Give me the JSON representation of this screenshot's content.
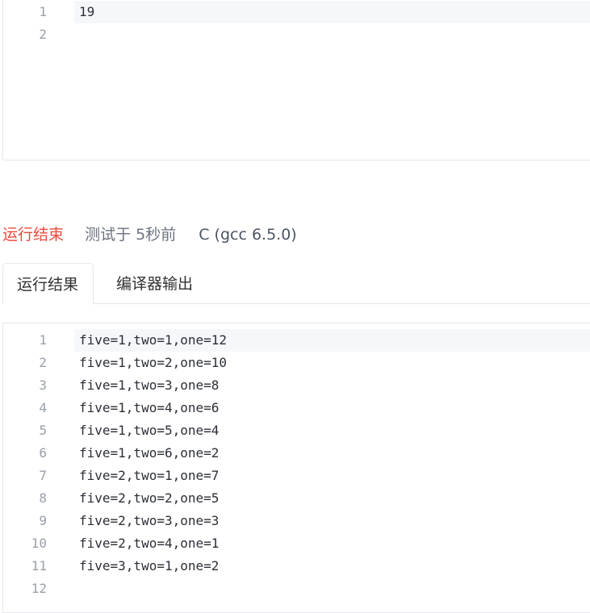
{
  "input_editor": {
    "lines": [
      {
        "num": "1",
        "text": "19"
      },
      {
        "num": "2",
        "text": ""
      }
    ]
  },
  "status": {
    "result": "运行结束",
    "time": "测试于 5秒前",
    "language": "C (gcc 6.5.0)"
  },
  "tabs": {
    "run_result": "运行结果",
    "compiler_output": "编译器输出"
  },
  "output_editor": {
    "lines": [
      {
        "num": "1",
        "text": "five=1,two=1,one=12"
      },
      {
        "num": "2",
        "text": "five=1,two=2,one=10"
      },
      {
        "num": "3",
        "text": "five=1,two=3,one=8"
      },
      {
        "num": "4",
        "text": "five=1,two=4,one=6"
      },
      {
        "num": "5",
        "text": "five=1,two=5,one=4"
      },
      {
        "num": "6",
        "text": "five=1,two=6,one=2"
      },
      {
        "num": "7",
        "text": "five=2,two=1,one=7"
      },
      {
        "num": "8",
        "text": "five=2,two=2,one=5"
      },
      {
        "num": "9",
        "text": "five=2,two=3,one=3"
      },
      {
        "num": "10",
        "text": "five=2,two=4,one=1"
      },
      {
        "num": "11",
        "text": "five=3,two=1,one=2"
      },
      {
        "num": "12",
        "text": ""
      }
    ]
  },
  "colors": {
    "status_result": "#e84a3c",
    "active_line": "#f5f7fa",
    "border": "#e4e7ed"
  }
}
